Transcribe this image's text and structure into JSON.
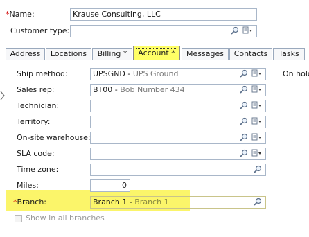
{
  "header": {
    "name_label": "Name:",
    "name_required_mark": "*",
    "name_value": "Krause Consulting, LLC",
    "customer_type_label": "Customer type:",
    "customer_type_value": ""
  },
  "tabs": [
    {
      "label": "Address"
    },
    {
      "label": "Locations"
    },
    {
      "label": "Billing",
      "marker": "*"
    },
    {
      "label": "Account *",
      "active": true
    },
    {
      "label": "Messages"
    },
    {
      "label": "Contacts"
    },
    {
      "label": "Tasks"
    }
  ],
  "account": {
    "ship_method": {
      "label": "Ship method:",
      "code": "UPSGND",
      "desc": "UPS Ground"
    },
    "on_hold_label": "On hold",
    "sales_rep": {
      "label": "Sales rep:",
      "code": "BT00",
      "desc": "Bob Number 434"
    },
    "technician": {
      "label": "Technician:"
    },
    "territory": {
      "label": "Territory:"
    },
    "onsite_warehouse": {
      "label": "On-site warehouse:"
    },
    "sla_code": {
      "label": "SLA code:"
    },
    "time_zone": {
      "label": "Time zone:"
    },
    "miles": {
      "label": "Miles:",
      "value": "0"
    },
    "branch": {
      "label": "Branch:",
      "required_mark": "*",
      "code": "Branch 1",
      "desc": "Branch 1"
    },
    "show_all_branches": {
      "label": "Show in all branches",
      "checked": false
    }
  },
  "colors": {
    "highlight": "#fbf56a",
    "required": "#d10000",
    "field_border": "#a9b7c9"
  },
  "icons": {
    "lookup": "magnifier-icon",
    "options": "document-dropdown-icon"
  }
}
